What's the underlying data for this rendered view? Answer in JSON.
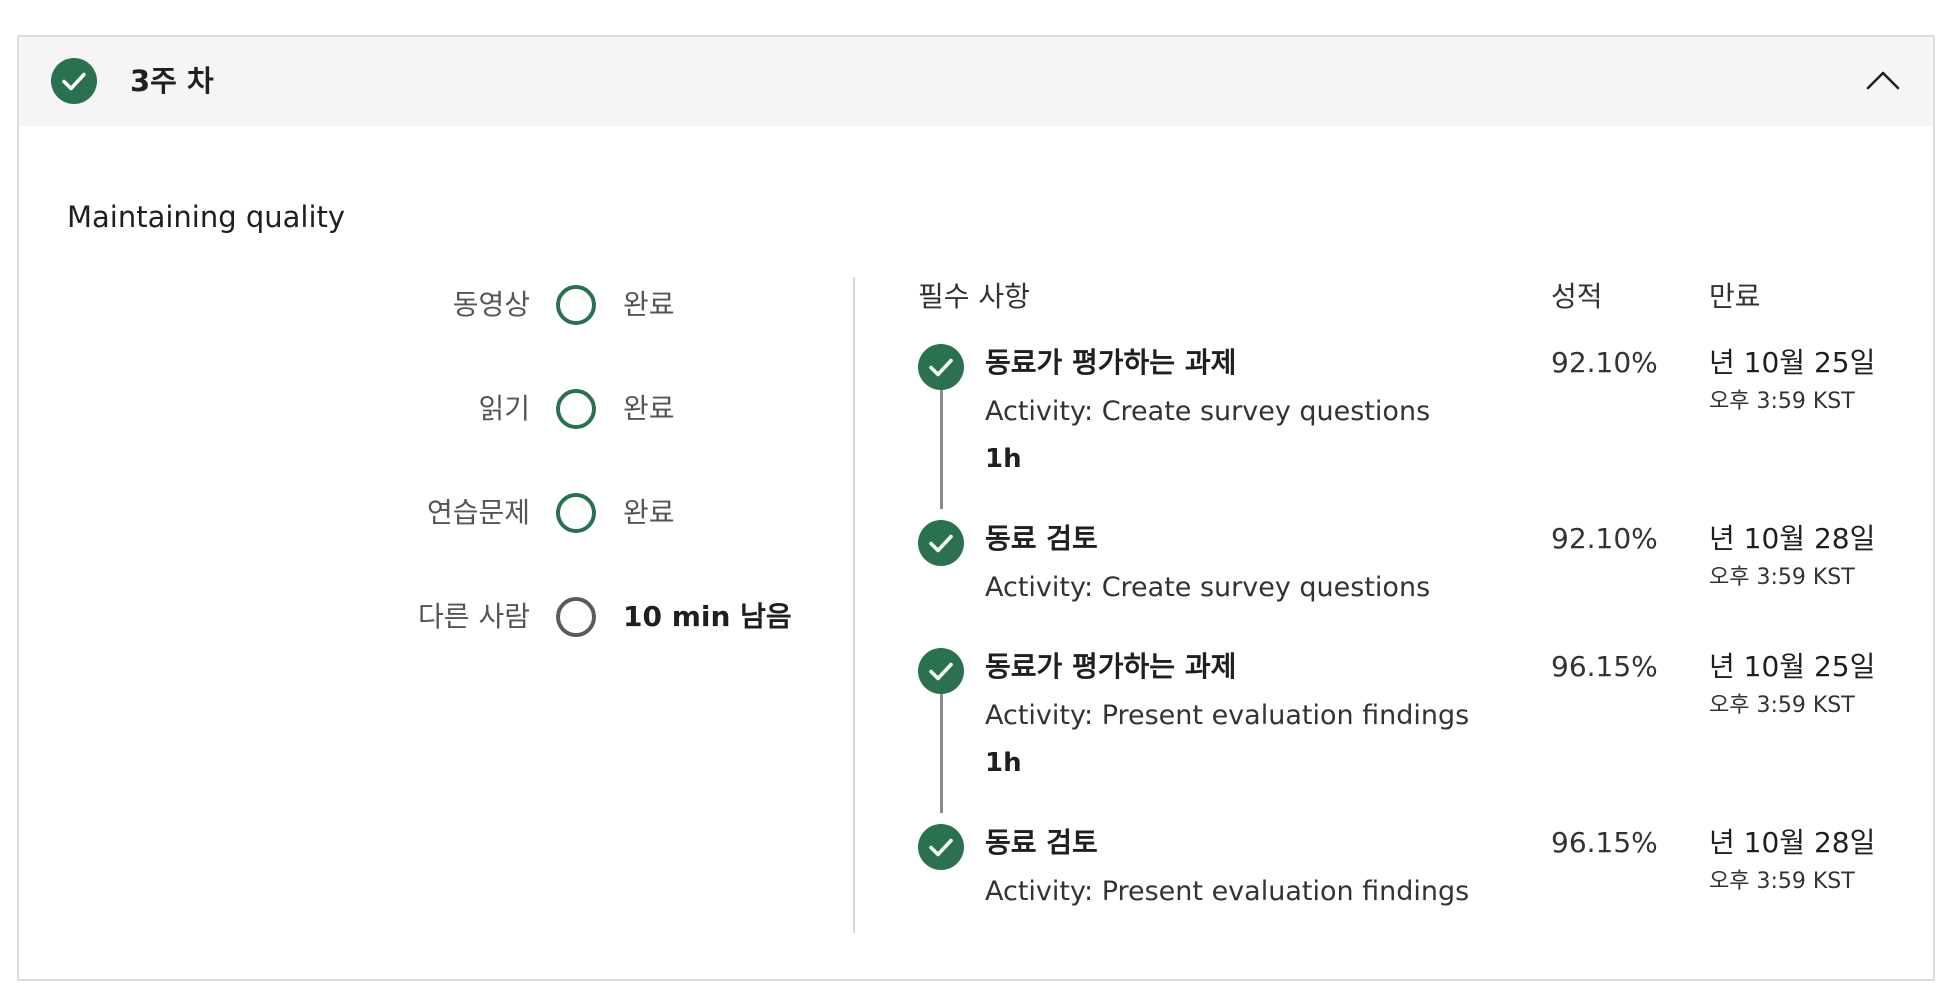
{
  "week": {
    "title": "3주 차"
  },
  "module": {
    "title": "Maintaining quality"
  },
  "summary": [
    {
      "label": "동영상",
      "status": "완료",
      "state": "done"
    },
    {
      "label": "읽기",
      "status": "완료",
      "state": "done"
    },
    {
      "label": "연습문제",
      "status": "완료",
      "state": "done"
    },
    {
      "label": "다른 사람",
      "status": "10 min 남음",
      "state": "pending"
    }
  ],
  "columns": {
    "required": "필수 사항",
    "grade": "성적",
    "due": "만료"
  },
  "items": [
    {
      "name": "동료가 평가하는 과제",
      "activity": "Activity: Create survey questions",
      "duration": "1h",
      "grade": "92.10%",
      "due_date": "년 10월 25일",
      "due_time": "오후 3:59 KST"
    },
    {
      "name": "동료 검토",
      "activity": "Activity: Create survey questions",
      "duration": "",
      "grade": "92.10%",
      "due_date": "년 10월 28일",
      "due_time": "오후 3:59 KST"
    },
    {
      "name": "동료가 평가하는 과제",
      "activity": "Activity: Present evaluation findings",
      "duration": "1h",
      "grade": "96.15%",
      "due_date": "년 10월 25일",
      "due_time": "오후 3:59 KST"
    },
    {
      "name": "동료 검토",
      "activity": "Activity: Present evaluation findings",
      "duration": "",
      "grade": "96.15%",
      "due_date": "년 10월 28일",
      "due_time": "오후 3:59 KST"
    }
  ],
  "icons": {
    "week_status": "check-circle-icon",
    "collapse": "chevron-up-icon",
    "item_status": "check-circle-icon",
    "summary_done": "ring-complete-icon",
    "summary_pending": "ring-pending-icon"
  },
  "colors": {
    "accent": "#2a7150",
    "header_bg": "#f5f5f5",
    "pending": "#5b5b5b"
  }
}
